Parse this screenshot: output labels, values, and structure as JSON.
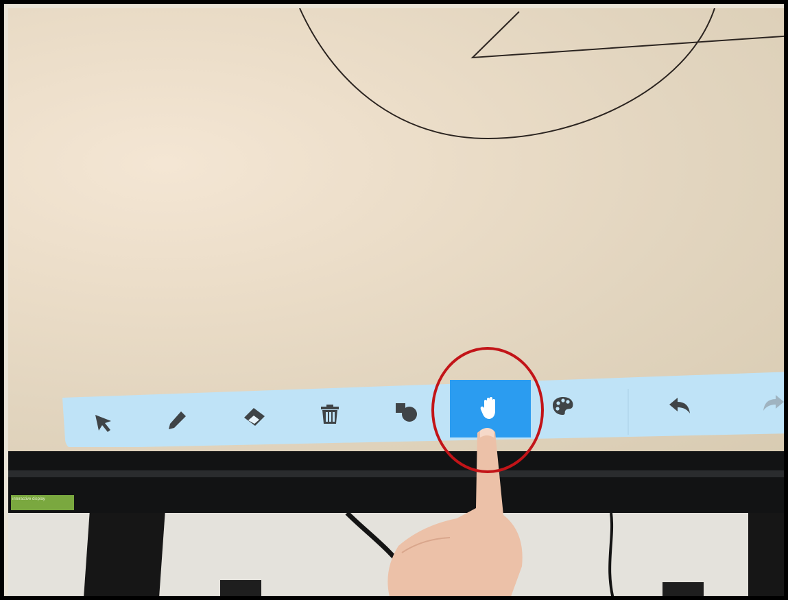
{
  "toolbar": {
    "tools": [
      {
        "name": "select",
        "icon": "pointer-arrow-icon",
        "active": false
      },
      {
        "name": "pen",
        "icon": "pen-icon",
        "active": false
      },
      {
        "name": "eraser",
        "icon": "eraser-icon",
        "active": false
      },
      {
        "name": "delete",
        "icon": "trash-icon",
        "active": false
      },
      {
        "name": "shapes",
        "icon": "shapes-icon",
        "active": false
      },
      {
        "name": "pan",
        "icon": "hand-icon",
        "active": true
      },
      {
        "name": "color",
        "icon": "palette-icon",
        "active": false
      },
      {
        "name": "undo",
        "icon": "undo-icon",
        "active": false
      },
      {
        "name": "redo",
        "icon": "redo-icon",
        "active": false,
        "disabled": true
      }
    ]
  },
  "colors": {
    "toolbar_bg": "#bfe3f7",
    "active_bg": "#2b9cf0",
    "icon": "#3f4447",
    "icon_disabled": "#9fb3c0",
    "highlight_circle": "#c21418",
    "stroke": "#2b2420"
  },
  "monitor_sticker": {
    "text": "interactive display"
  }
}
